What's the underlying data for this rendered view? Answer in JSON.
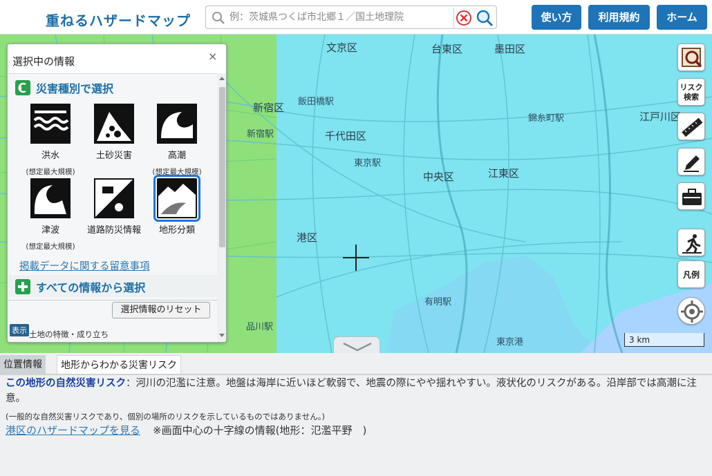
{
  "header": {
    "logo": "重ねるハザードマップ",
    "search_placeholder": "例：茨城県つくば市北郷１／国土地理院",
    "buttons": [
      "使い方",
      "利用規約",
      "ホーム"
    ]
  },
  "map": {
    "labels": [
      "文京区",
      "台東区",
      "墨田区",
      "新宿区",
      "千代田区",
      "中央区",
      "江東区",
      "江戸川区",
      "港区",
      "新宿駅",
      "飯田橋駅",
      "東京駅",
      "錦糸町駅",
      "品川駅",
      "東京港",
      "有明駅"
    ],
    "tools": [
      {
        "icon": "magnify-map-icon",
        "text": ""
      },
      {
        "icon": "risk-search-icon",
        "text": "リスク検索"
      },
      {
        "icon": "ruler-icon",
        "text": ""
      },
      {
        "icon": "pencil-icon",
        "text": ""
      },
      {
        "icon": "toolbox-icon",
        "text": ""
      },
      {
        "icon": "evacuation-icon",
        "text": ""
      },
      {
        "icon": "legend-icon",
        "text": "凡例"
      },
      {
        "icon": "gps-icon",
        "text": ""
      }
    ],
    "scale_label": "3 km",
    "colors": {
      "water_zone": "#7fe3f0",
      "green_zone": "#8fe07a",
      "sea": "#9fd9ff"
    }
  },
  "panel": {
    "title": "選択中の情報",
    "close": "×",
    "section1": "災害種別で選択",
    "hazards": [
      {
        "label": "洪水",
        "sub": "(想定最大規模)",
        "icon": "flood-icon",
        "selected": false
      },
      {
        "label": "土砂災害",
        "sub": "",
        "icon": "landslide-icon",
        "selected": false
      },
      {
        "label": "高潮",
        "sub": "(想定最大規模)",
        "icon": "storm-surge-icon",
        "selected": false
      },
      {
        "label": "津波",
        "sub": "(想定最大規模)",
        "icon": "tsunami-icon",
        "selected": false
      },
      {
        "label": "道路防災情報",
        "sub": "",
        "icon": "road-disaster-icon",
        "selected": false
      },
      {
        "label": "地形分類",
        "sub": "",
        "icon": "landform-icon",
        "selected": true
      }
    ],
    "notice_link": "掲載データに関する留意事項",
    "section2": "すべての情報から選択",
    "reset": "選択情報のリセット",
    "display_badge": "表示",
    "last_item": "土地の特徴・成り立ち"
  },
  "info": {
    "tabs": [
      "位置情報",
      "地形からわかる災害リスク"
    ],
    "risk_title": "この地形の自然災害リスク",
    "risk_text": "：河川の氾濫に注意。地盤は海岸に近いほど軟弱で、地震の際にやや揺れやすい。液状化のリスクがある。沿岸部では高潮に注意。",
    "note": "(一般的な自然災害リスクであり、個別の場所のリスクを示しているものではありません。)",
    "hazard_link": "港区のハザードマップを見る",
    "center_info": "※画面中心の十字線の情報(地形：氾濫平野　)"
  }
}
